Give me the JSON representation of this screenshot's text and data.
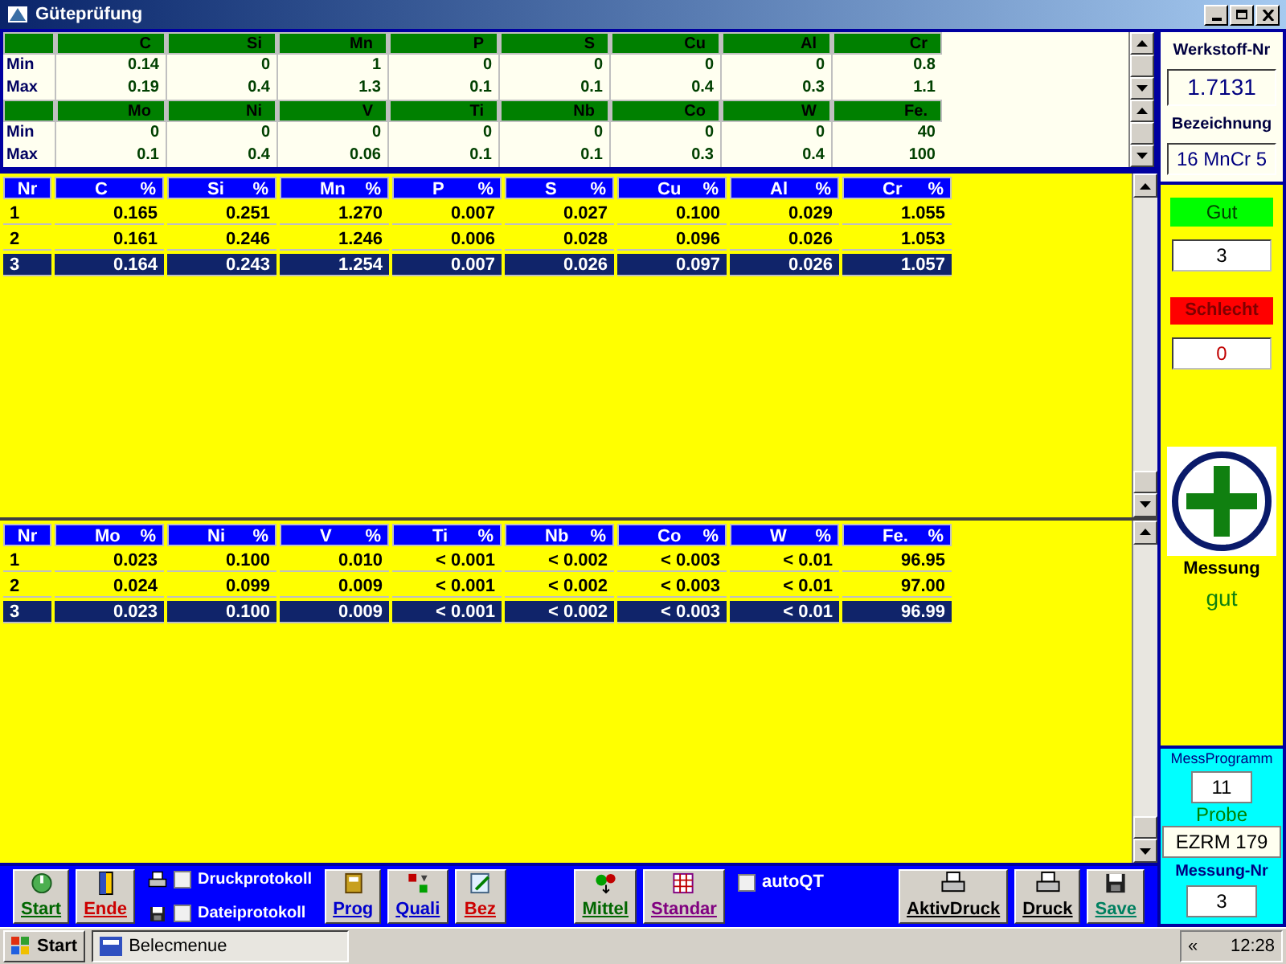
{
  "window": {
    "title": "Güteprüfung"
  },
  "limits": [
    {
      "columns": [
        "C",
        "Si",
        "Mn",
        "P",
        "S",
        "Cu",
        "Al",
        "Cr"
      ],
      "rows": [
        {
          "label": "Min",
          "values": [
            "0.14",
            "0",
            "1",
            "0",
            "0",
            "0",
            "0",
            "0.8"
          ]
        },
        {
          "label": "Max",
          "values": [
            "0.19",
            "0.4",
            "1.3",
            "0.1",
            "0.1",
            "0.4",
            "0.3",
            "1.1"
          ]
        }
      ]
    },
    {
      "columns": [
        "Mo",
        "Ni",
        "V",
        "Ti",
        "Nb",
        "Co",
        "W",
        "Fe."
      ],
      "rows": [
        {
          "label": "Min",
          "values": [
            "0",
            "0",
            "0",
            "0",
            "0",
            "0",
            "0",
            "40"
          ]
        },
        {
          "label": "Max",
          "values": [
            "0.1",
            "0.4",
            "0.06",
            "0.1",
            "0.1",
            "0.3",
            "0.4",
            "100"
          ]
        }
      ]
    }
  ],
  "results": [
    {
      "columns": [
        "Nr",
        "C",
        "Si",
        "Mn",
        "P",
        "S",
        "Cu",
        "Al",
        "Cr"
      ],
      "unit": "%",
      "rows": [
        {
          "nr": "1",
          "values": [
            "0.165",
            "0.251",
            "1.270",
            "0.007",
            "0.027",
            "0.100",
            "0.029",
            "1.055"
          ],
          "selected": false
        },
        {
          "nr": "2",
          "values": [
            "0.161",
            "0.246",
            "1.246",
            "0.006",
            "0.028",
            "0.096",
            "0.026",
            "1.053"
          ],
          "selected": false
        },
        {
          "nr": "3",
          "values": [
            "0.164",
            "0.243",
            "1.254",
            "0.007",
            "0.026",
            "0.097",
            "0.026",
            "1.057"
          ],
          "selected": true
        }
      ]
    },
    {
      "columns": [
        "Nr",
        "Mo",
        "Ni",
        "V",
        "Ti",
        "Nb",
        "Co",
        "W",
        "Fe."
      ],
      "unit": "%",
      "rows": [
        {
          "nr": "1",
          "values": [
            "0.023",
            "0.100",
            "0.010",
            "< 0.001",
            "< 0.002",
            "< 0.003",
            "< 0.01",
            "96.95"
          ],
          "selected": false
        },
        {
          "nr": "2",
          "values": [
            "0.024",
            "0.099",
            "0.009",
            "< 0.001",
            "< 0.002",
            "< 0.003",
            "< 0.01",
            "97.00"
          ],
          "selected": false
        },
        {
          "nr": "3",
          "values": [
            "0.023",
            "0.100",
            "0.009",
            "< 0.001",
            "< 0.002",
            "< 0.003",
            "< 0.01",
            "96.99"
          ],
          "selected": true
        }
      ]
    }
  ],
  "material": {
    "number_label": "Werkstoff-Nr",
    "number": "1.7131",
    "name_label": "Bezeichnung",
    "name": "16 MnCr 5"
  },
  "counters": {
    "good_label": "Gut",
    "good": "3",
    "bad_label": "Schlecht",
    "bad": "0"
  },
  "verdict": {
    "label": "Messung",
    "status": "gut",
    "kind": "good"
  },
  "program": {
    "program_label": "MessProgramm",
    "program": "11",
    "sample_label": "Probe",
    "sample": "EZRM 179",
    "measurement_label": "Messung-Nr",
    "measurement": "3"
  },
  "toolbar": [
    {
      "kind": "button",
      "label": "Start",
      "color": "#006600"
    },
    {
      "kind": "button",
      "label": "Ende",
      "color": "#cc0000"
    },
    {
      "kind": "checks",
      "items": [
        {
          "label": "Druckprotokoll",
          "checked": false
        },
        {
          "label": "Dateiprotokoll",
          "checked": false
        }
      ]
    },
    {
      "kind": "button",
      "label": "Prog",
      "color": "#0000cc"
    },
    {
      "kind": "button",
      "label": "Quali",
      "color": "#0000cc"
    },
    {
      "kind": "button",
      "label": "Bez",
      "color": "#cc0000"
    },
    {
      "kind": "spacer"
    },
    {
      "kind": "button",
      "label": "Mittel",
      "color": "#006600"
    },
    {
      "kind": "button",
      "label": "Standar",
      "color": "#800080"
    },
    {
      "kind": "check",
      "label": "autoQT",
      "checked": false
    },
    {
      "kind": "spacer"
    },
    {
      "kind": "button",
      "label": "AktivDruck",
      "color": "#000000"
    },
    {
      "kind": "button",
      "label": "Druck",
      "color": "#000000"
    },
    {
      "kind": "button",
      "label": "Save",
      "color": "#008060"
    }
  ],
  "taskbar": {
    "start": "Start",
    "task": "Belecmenue",
    "chevron": "«",
    "clock": "12:28"
  }
}
